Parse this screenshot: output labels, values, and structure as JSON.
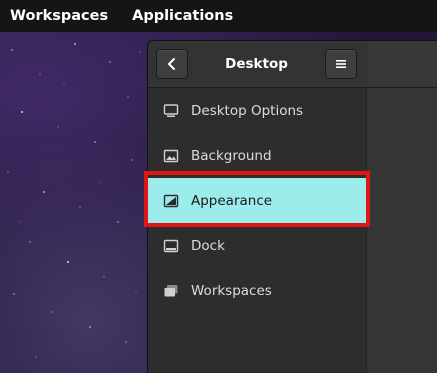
{
  "top_panel": {
    "items": [
      "Workspaces",
      "Applications"
    ]
  },
  "window": {
    "title": "Desktop",
    "back_icon": "chevron-left-icon",
    "menu_icon": "hamburger-menu-icon"
  },
  "sidebar": {
    "items": [
      {
        "label": "Desktop Options",
        "icon": "monitor-icon",
        "selected": false
      },
      {
        "label": "Background",
        "icon": "image-icon",
        "selected": false
      },
      {
        "label": "Appearance",
        "icon": "appearance-icon",
        "selected": true
      },
      {
        "label": "Dock",
        "icon": "dock-icon",
        "selected": false
      },
      {
        "label": "Workspaces",
        "icon": "workspaces-icon",
        "selected": false
      }
    ]
  },
  "colors": {
    "selected_bg": "#9cecec",
    "highlight_border": "#e01515",
    "panel_bg": "#151515"
  }
}
